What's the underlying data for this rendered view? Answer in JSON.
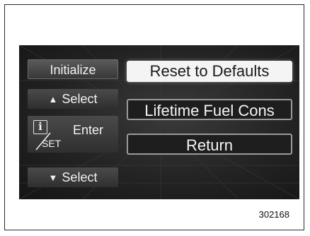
{
  "menu": {
    "initialize_label": "Initialize",
    "select_up_label": "Select",
    "set_label": "SET",
    "enter_label": "Enter",
    "select_down_label": "Select",
    "info_glyph": "i"
  },
  "options": {
    "reset_label": "Reset to Defaults",
    "lifetime_label": "Lifetime Fuel Cons",
    "return_label": "Return"
  },
  "footer": {
    "figure_number": "302168"
  },
  "icons": {
    "up": "triangle-up-icon",
    "down": "triangle-down-icon",
    "info": "info-icon"
  },
  "colors": {
    "screen_bg": "#232323",
    "selected_bg": "#f4f4f4",
    "outline": "#9a9a9a"
  }
}
